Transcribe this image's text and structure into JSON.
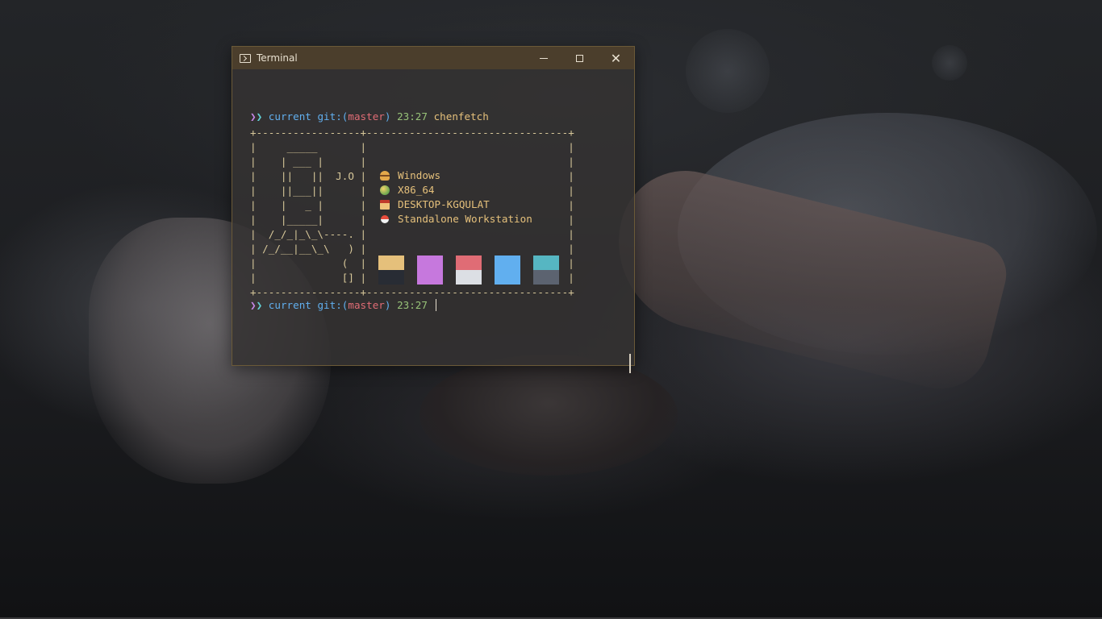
{
  "window": {
    "title": "Terminal",
    "controls": {
      "minimize": "minimize",
      "maximize": "maximize",
      "close": "✕"
    }
  },
  "prompt1": {
    "arrows": "❯",
    "arrows2": "❯",
    "dir": "current",
    "git_prefix": "git:(",
    "branch": "master",
    "git_suffix": ")",
    "time": "23:27",
    "command": "chenfetch"
  },
  "ascii_box": "+-----------------+---------------------------------+\n|     _____       |                                 |\n|    | ___ |      |                                 |\n|    ||   ||  J.O |                                 |\n|    ||___||      |                                 |\n|    |   _ |      |                                 |\n|    |_____|      |                                 |\n|  /_/_|_\\_\\----. |                                 |\n| /_/__|__\\_\\   ) |                                 |\n|              (  |                                 |\n|              [] |                                 |\n+-----------------+---------------------------------+",
  "info": [
    {
      "icon": "burger-icon",
      "text": "Windows"
    },
    {
      "icon": "mango-icon",
      "text": "X86_64"
    },
    {
      "icon": "house-icon",
      "text": "DESKTOP-KGQULAT"
    },
    {
      "icon": "pokeball-icon",
      "text": "Standalone Workstation"
    }
  ],
  "swatches": [
    {
      "top": "#e5c07b",
      "bottom": "#282c34"
    },
    {
      "top": "#c678dd",
      "bottom": "#c678dd"
    },
    {
      "top": "#e06c75",
      "bottom": "#dcdfe4"
    },
    {
      "top": "#61afef",
      "bottom": "#61afef"
    },
    {
      "top": "#56b6c2",
      "bottom": "#5c6370"
    }
  ],
  "prompt2": {
    "arrows": "❯",
    "arrows2": "❯",
    "dir": "current",
    "git_prefix": "git:(",
    "branch": "master",
    "git_suffix": ")",
    "time": "23:27"
  }
}
